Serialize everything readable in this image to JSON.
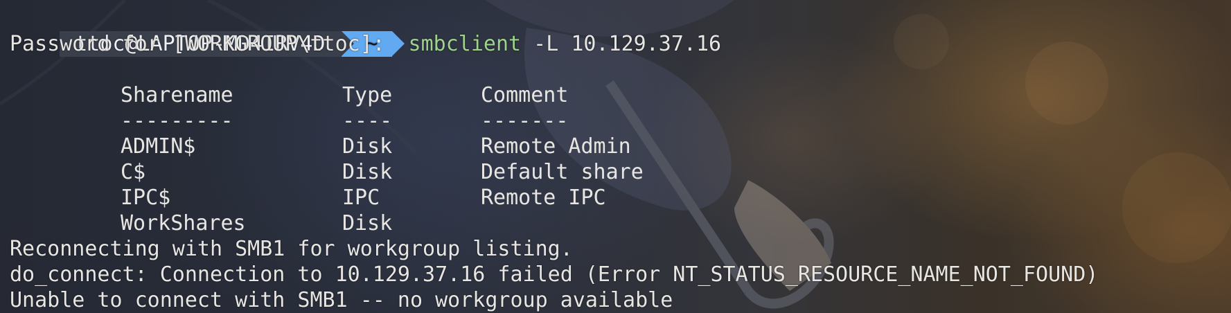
{
  "prompt": {
    "host": "ttoc@LAPTOP-MD4IRV4D",
    "dir": "~",
    "command": "smbclient",
    "args": " -L 10.129.37.16"
  },
  "password_prompt": "Password for [WORKGROUP\\ttoc]:",
  "table": {
    "headers": [
      "Sharename",
      "Type",
      "Comment"
    ],
    "separators": [
      "---------",
      "----",
      "-------"
    ],
    "rows": [
      {
        "name": "ADMIN$",
        "type": "Disk",
        "comment": "Remote Admin"
      },
      {
        "name": "C$",
        "type": "Disk",
        "comment": "Default share"
      },
      {
        "name": "IPC$",
        "type": "IPC",
        "comment": "Remote IPC"
      },
      {
        "name": "WorkShares",
        "type": "Disk",
        "comment": ""
      }
    ]
  },
  "output_lines": [
    "Reconnecting with SMB1 for workgroup listing.",
    "do_connect: Connection to 10.129.37.16 failed (Error NT_STATUS_RESOURCE_NAME_NOT_FOUND)",
    "Unable to connect with SMB1 -- no workgroup available"
  ],
  "colors": {
    "command": "#9fd28a",
    "prompt_dir_bg": "#61a9f0",
    "prompt_host_bg": "#3a3f4c"
  }
}
